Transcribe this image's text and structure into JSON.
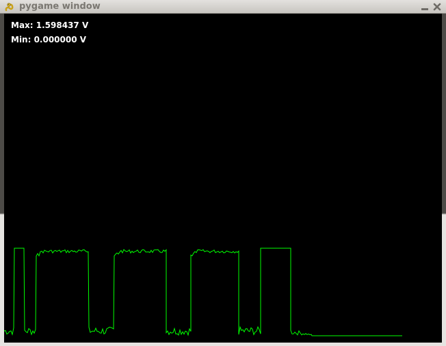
{
  "window": {
    "title": "pygame window",
    "icons": {
      "app": "pygame-snake-icon",
      "minimize": "minimize-icon",
      "close": "close-icon"
    }
  },
  "readouts": {
    "max_label": "Max: 1.598437 V",
    "min_label": "Min: 0.000000 V"
  },
  "colors": {
    "trace": "#00ff00",
    "background": "#000000",
    "text": "#ffffff"
  }
}
